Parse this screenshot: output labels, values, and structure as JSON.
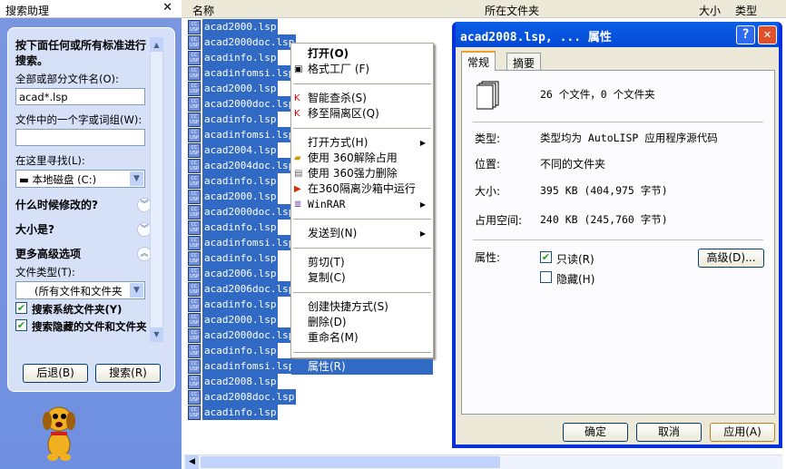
{
  "search_pane": {
    "title": "搜索助理",
    "intro": "按下面任何或所有标准进行搜索。",
    "filename_label": "全部或部分文件名(O):",
    "filename_value": "acad*.lsp",
    "word_label": "文件中的一个字或词组(W):",
    "word_value": "",
    "lookin_label": "在这里寻找(L):",
    "lookin_value": "本地磁盘 (C:)",
    "when_label": "什么时候修改的?",
    "size_label": "大小是?",
    "advanced_label": "更多高级选项",
    "filetype_label": "文件类型(T):",
    "filetype_value": "(所有文件和文件夹",
    "cb_system": {
      "label": "搜索系统文件夹(Y)",
      "checked": true
    },
    "cb_hidden": {
      "label": "搜索隐藏的文件和文件夹",
      "checked": true
    },
    "back": "后退(B)",
    "search": "搜索(R)"
  },
  "list": {
    "headers": [
      "名称",
      "所在文件夹",
      "大小",
      "类型"
    ],
    "files": [
      "acad2000.lsp",
      "acad2000doc.lsp",
      "acadinfo.lsp",
      "acadinfomsi.lsp",
      "acad2000.lsp",
      "acad2000doc.lsp",
      "acadinfo.lsp",
      "acadinfomsi.lsp",
      "acad2004.lsp",
      "acad2004doc.lsp",
      "acadinfo.lsp",
      "acad2000.lsp",
      "acad2000doc.lsp",
      "acadinfo.lsp",
      "acadinfomsi.lsp",
      "acadinfo.lsp",
      "acad2006.lsp",
      "acad2006doc.lsp",
      "acadinfo.lsp",
      "acad2000.lsp",
      "acad2000doc.lsp",
      "acadinfo.lsp",
      "acadinfomsi.lsp",
      "acad2008.lsp",
      "acad2008doc.lsp",
      "acadinfo.lsp"
    ],
    "file_icon_text": "CC USP"
  },
  "menu": {
    "open": "打开(O)",
    "format_factory": "格式工厂 (F)",
    "scan": "智能查杀(S)",
    "quarantine": "移至隔离区(Q)",
    "open_with": "打开方式(H)",
    "unlock": "使用 360解除占用",
    "force_delete": "使用 360强力删除",
    "sandbox": "在360隔离沙箱中运行",
    "winrar": "WinRAR",
    "send_to": "发送到(N)",
    "cut": "剪切(T)",
    "copy": "复制(C)",
    "shortcut": "创建快捷方式(S)",
    "delete": "删除(D)",
    "rename": "重命名(M)",
    "properties": "属性(R)"
  },
  "dialog": {
    "title": "acad2008.lsp, ... 属性",
    "tabs": [
      "常规",
      "摘要"
    ],
    "summary": "26 个文件，0 个文件夹",
    "type_label": "类型:",
    "type_value": "类型均为 AutoLISP 应用程序源代码",
    "loc_label": "位置:",
    "loc_value": "不同的文件夹",
    "size_label": "大小:",
    "size_value": "395 KB (404,975 字节)",
    "disk_label": "占用空间:",
    "disk_value": "240 KB (245,760 字节)",
    "attr_label": "属性:",
    "readonly": {
      "label": "只读(R)",
      "checked": true
    },
    "hidden": {
      "label": "隐藏(H)",
      "checked": false
    },
    "advanced": "高级(D)...",
    "ok": "确定",
    "cancel": "取消",
    "apply": "应用(A)"
  }
}
